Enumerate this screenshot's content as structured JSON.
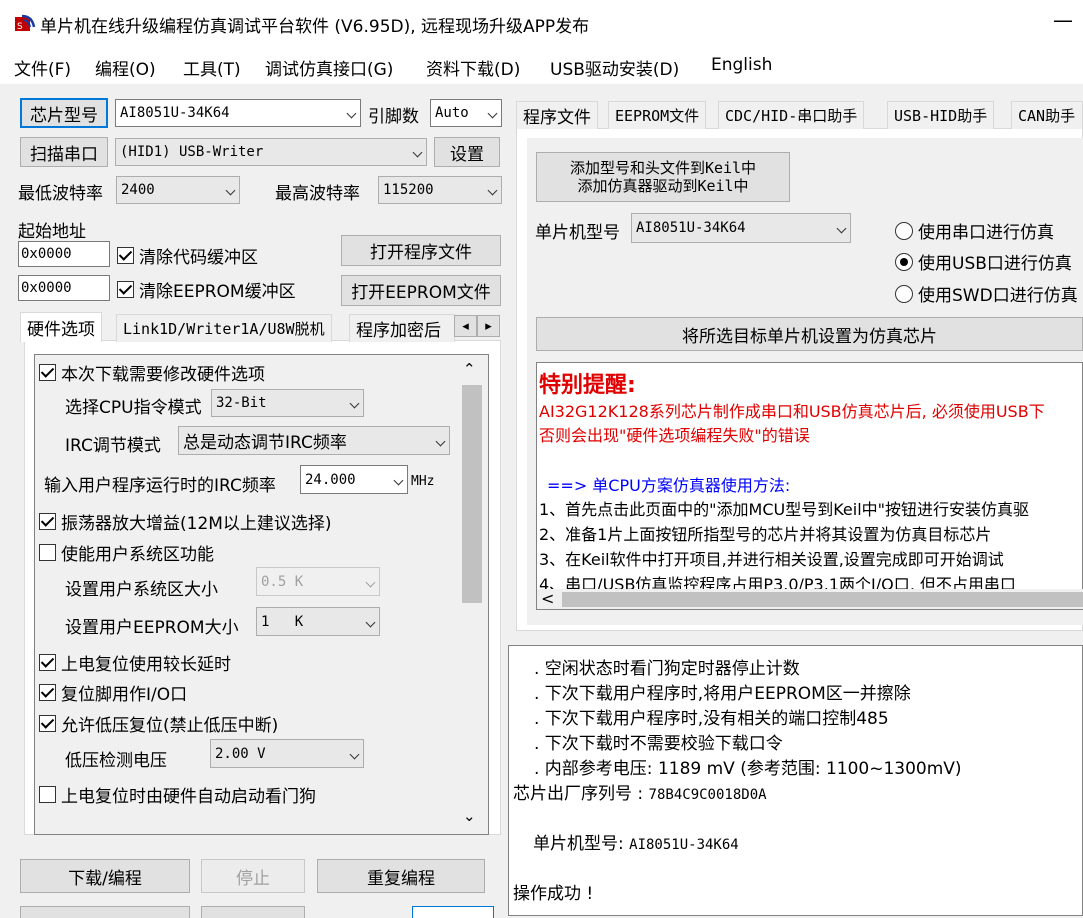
{
  "window": {
    "title": "单片机在线升级编程仿真调试平台软件 (V6.95D), 远程现场升级APP发布",
    "minimize": "—"
  },
  "menu": [
    "文件(F)",
    "编程(O)",
    "工具(T)",
    "调试仿真接口(G)",
    "资料下载(D)",
    "USB驱动安装(D)",
    "English"
  ],
  "left": {
    "chip_btn": "芯片型号",
    "chip_value": "AI8051U-34K64",
    "pins_label": "引脚数",
    "pins_value": "Auto",
    "scan_btn": "扫描串口",
    "port_value": "(HID1) USB-Writer",
    "settings_btn": "设置",
    "min_baud_label": "最低波特率",
    "min_baud_value": "2400",
    "max_baud_label": "最高波特率",
    "max_baud_value": "115200",
    "start_addr_label": "起始地址",
    "addr1": "0x0000",
    "clear_code": "清除代码缓冲区",
    "open_prog_btn": "打开程序文件",
    "addr2": "0x0000",
    "clear_eeprom": "清除EEPROM缓冲区",
    "open_eeprom_btn": "打开EEPROM文件",
    "tabs": [
      "硬件选项",
      "Link1D/Writer1A/U8W脱机",
      "程序加密后"
    ],
    "tab_prev": "◂",
    "tab_next": "▸",
    "options": {
      "modify_hw": "本次下载需要修改硬件选项",
      "cpu_mode_label": "选择CPU指令模式",
      "cpu_mode_value": "32-Bit",
      "irc_mode_label": "IRC调节模式",
      "irc_mode_value": "总是动态调节IRC频率",
      "irc_freq_label": "输入用户程序运行时的IRC频率",
      "irc_freq_value": "24.000",
      "irc_freq_unit": "MHz",
      "osc_gain": "振荡器放大增益(12M以上建议选择)",
      "user_sys_enable": "使能用户系统区功能",
      "user_sys_size_label": "设置用户系统区大小",
      "user_sys_size_value": "0.5 K",
      "user_eeprom_label": "设置用户EEPROM大小",
      "user_eeprom_value": "1   K",
      "long_reset": "上电复位使用较长延时",
      "reset_io": "复位脚用作I/O口",
      "lvr": "允许低压复位(禁止低压中断)",
      "lvd_label": "低压检测电压",
      "lvd_value": "2.00 V",
      "wdt_auto": "上电复位时由硬件自动启动看门狗"
    },
    "download_btn": "下载/编程",
    "stop_btn": "停止",
    "repeat_btn": "重复编程"
  },
  "right": {
    "tabs": [
      "程序文件",
      "EEPROM文件",
      "CDC/HID-串口助手",
      "USB-HID助手",
      "CAN助手"
    ],
    "add_keil_line1": "添加型号和头文件到Keil中",
    "add_keil_line2": "添加仿真器驱动到Keil中",
    "mcu_label": "单片机型号",
    "mcu_value": "AI8051U-34K64",
    "radio_serial": "使用串口进行仿真",
    "radio_usb": "使用USB口进行仿真",
    "radio_swd": "使用SWD口进行仿真",
    "set_target_btn": "将所选目标单片机设置为仿真芯片",
    "note_title": "特别提醒:",
    "note_red1": "AI32G12K128系列芯片制作成串口和USB仿真芯片后, 必须使用USB下",
    "note_red2": "否则会出现\"硬件选项编程失败\"的错误",
    "note_blue": "==> 单CPU方案仿真器使用方法:",
    "note_steps": [
      "1、首先点击此页面中的\"添加MCU型号到Keil中\"按钮进行安装仿真驱",
      "2、准备1片上面按钮所指型号的芯片并将其设置为仿真目标芯片",
      "3、在Keil软件中打开项目,并进行相关设置,设置完成即可开始调试",
      "4、串口/USB仿真监控程序占用P3.0/P3.1两个I/O口, 但不占用串口"
    ],
    "scroll_left": "<"
  },
  "log": {
    "lines": [
      ". 空闲状态时看门狗定时器停止计数",
      ". 下次下载用户程序时,将用户EEPROM区一并擦除",
      ". 下次下载用户程序时,没有相关的端口控制485",
      ". 下次下载时不需要校验下载口令",
      ". 内部参考电压: 1189 mV (参考范围: 1100~1300mV)"
    ],
    "serial_label": "芯片出厂序列号 : ",
    "serial_value": "78B4C9C0018D0A",
    "mcu_label": "单片机型号: ",
    "mcu_value": "AI8051U-34K64",
    "result": "操作成功 !"
  },
  "colors": {
    "accent": "#0078d7",
    "note_red": "#e00000",
    "note_blue": "#0000ff"
  }
}
